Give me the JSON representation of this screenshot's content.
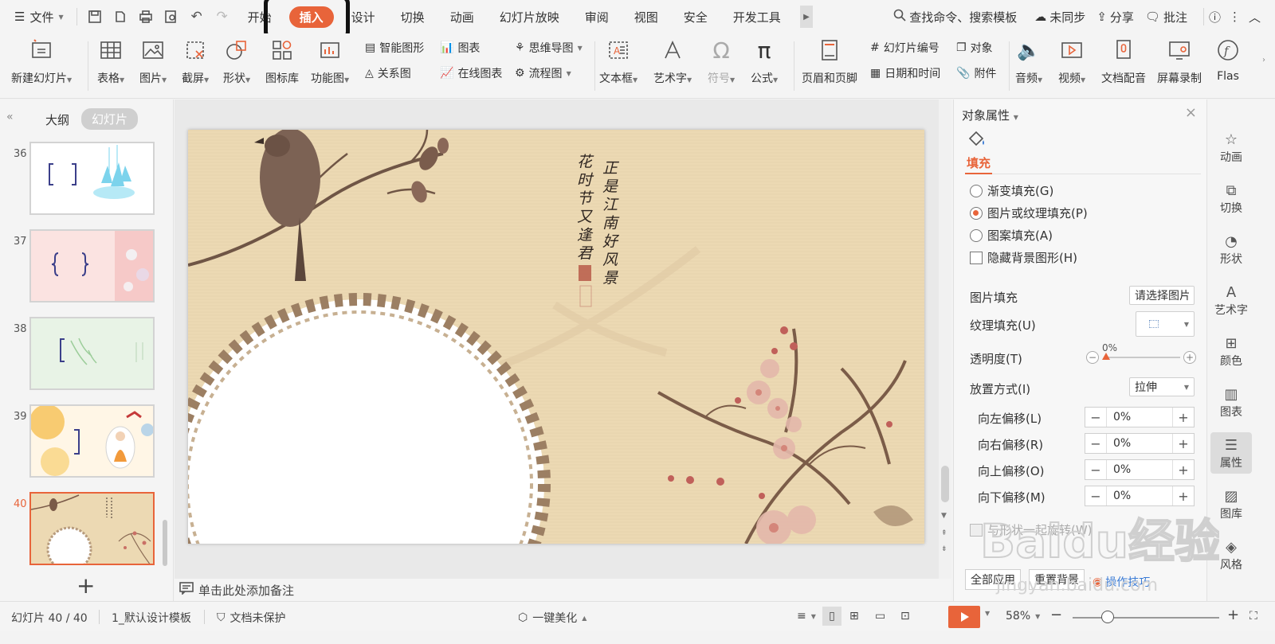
{
  "menubar": {
    "file_label": "文件",
    "tabs": [
      {
        "label": "开始"
      },
      {
        "label": "插入"
      },
      {
        "label": "设计"
      },
      {
        "label": "切换"
      },
      {
        "label": "动画"
      },
      {
        "label": "幻灯片放映"
      },
      {
        "label": "审阅"
      },
      {
        "label": "视图"
      },
      {
        "label": "安全"
      },
      {
        "label": "开发工具"
      }
    ],
    "active_tab": "插入",
    "search_placeholder": "查找命令、搜索模板",
    "sync_label": "未同步",
    "share_label": "分享",
    "comment_label": "批注"
  },
  "ribbon": {
    "new_slide": "新建幻灯片",
    "table": "表格",
    "picture": "图片",
    "screenshot": "截屏",
    "shape": "形状",
    "icon_library": "图标库",
    "function_chart": "功能图",
    "smart_art": "智能图形",
    "chart": "图表",
    "relation_chart": "关系图",
    "online_chart": "在线图表",
    "mind_map": "思维导图",
    "flowchart": "流程图",
    "textbox": "文本框",
    "wordart": "艺术字",
    "symbol": "符号",
    "formula": "公式",
    "header_footer": "页眉和页脚",
    "slide_number": "幻灯片编号",
    "object": "对象",
    "datetime": "日期和时间",
    "attachment": "附件",
    "audio": "音频",
    "video": "视频",
    "narration": "文档配音",
    "screen_record": "屏幕录制",
    "flash": "Flas"
  },
  "leftpanel": {
    "tab_outline": "大纲",
    "tab_slides": "幻灯片",
    "slides": [
      {
        "num": "36"
      },
      {
        "num": "37"
      },
      {
        "num": "38"
      },
      {
        "num": "39"
      },
      {
        "num": "40"
      }
    ]
  },
  "slide": {
    "calligraphy_col1": "正是江南好风景",
    "calligraphy_col2": "花时节又逢君"
  },
  "notes_placeholder": "单击此处添加备注",
  "properties": {
    "title": "对象属性",
    "fill_tab": "填充",
    "options": [
      {
        "label": "渐变填充(G)",
        "selected": false
      },
      {
        "label": "图片或纹理填充(P)",
        "selected": true
      },
      {
        "label": "图案填充(A)",
        "selected": false
      }
    ],
    "hide_bg_label": "隐藏背景图形(H)",
    "picture_fill_label": "图片填充",
    "picture_fill_btn": "请选择图片",
    "texture_fill_label": "纹理填充(U)",
    "transparency_label": "透明度(T)",
    "transparency_value": "0%",
    "placement_label": "放置方式(I)",
    "placement_value": "拉伸",
    "offsets": [
      {
        "label": "向左偏移(L)",
        "value": "0%"
      },
      {
        "label": "向右偏移(R)",
        "value": "0%"
      },
      {
        "label": "向上偏移(O)",
        "value": "0%"
      },
      {
        "label": "向下偏移(M)",
        "value": "0%"
      }
    ],
    "rotate_with_shape": "与形状一起旋转(W)",
    "apply_all": "全部应用",
    "reset_bg": "重置背景",
    "tips": "操作技巧"
  },
  "rightrail": {
    "items": [
      "动画",
      "切换",
      "形状",
      "艺术字",
      "颜色",
      "图表",
      "属性",
      "图库",
      "风格"
    ]
  },
  "statusbar": {
    "slide_counter": "幻灯片 40 / 40",
    "template": "1_默认设计模板",
    "protection": "文档未保护",
    "beautify": "一键美化",
    "zoom": "58%"
  },
  "watermark": {
    "brand": "Baidu经验",
    "url": "jingyan.baidu.com"
  },
  "colors": {
    "accent": "#e8643a",
    "slide_bg": "#ecd9b3"
  }
}
